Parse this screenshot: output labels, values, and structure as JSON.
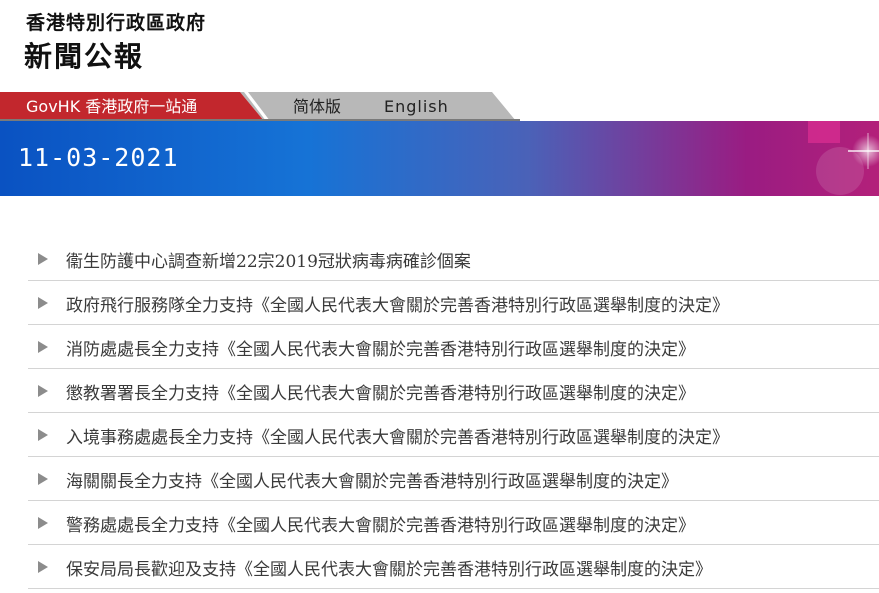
{
  "header": {
    "gov_name": "香港特別行政區政府",
    "bulletin_title": "新聞公報"
  },
  "nav": {
    "govhk": "GovHK 香港政府一站通",
    "simplified": "简体版",
    "english": "English"
  },
  "banner": {
    "date": "11-03-2021"
  },
  "news": [
    "衞生防護中心調查新增22宗2019冠狀病毒病確診個案",
    "政府飛行服務隊全力支持《全國人民代表大會關於完善香港特別行政區選舉制度的決定》",
    "消防處處長全力支持《全國人民代表大會關於完善香港特別行政區選舉制度的決定》",
    "懲教署署長全力支持《全國人民代表大會關於完善香港特別行政區選舉制度的決定》",
    "入境事務處處長全力支持《全國人民代表大會關於完善香港特別行政區選舉制度的決定》",
    "海關關長全力支持《全國人民代表大會關於完善香港特別行政區選舉制度的決定》",
    "警務處處長全力支持《全國人民代表大會關於完善香港特別行政區選舉制度的決定》",
    "保安局局長歡迎及支持《全國人民代表大會關於完善香港特別行政區選舉制度的決定》"
  ],
  "colors": {
    "govhk_tab": "#c2272d",
    "nav_gray": "#b5b5b5",
    "banner_blue": "#0a5cc6",
    "banner_magenta": "#a3147a"
  }
}
